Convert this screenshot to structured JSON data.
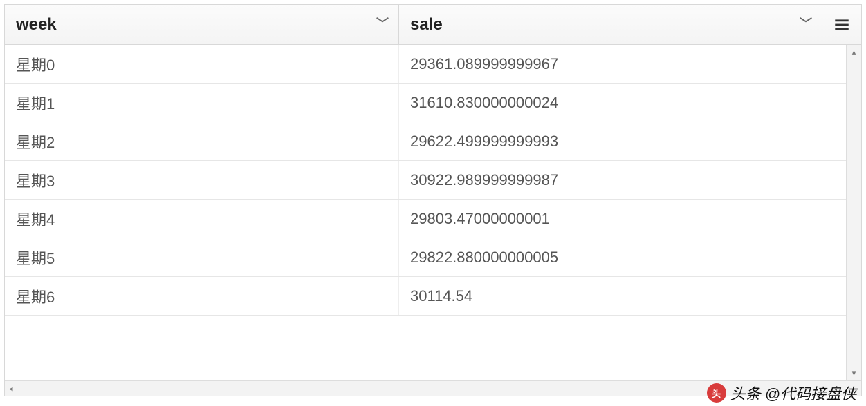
{
  "columns": [
    {
      "label": "week"
    },
    {
      "label": "sale"
    }
  ],
  "rows": [
    {
      "week": "星期0",
      "sale": "29361.089999999967"
    },
    {
      "week": "星期1",
      "sale": "31610.830000000024"
    },
    {
      "week": "星期2",
      "sale": "29622.499999999993"
    },
    {
      "week": "星期3",
      "sale": "30922.989999999987"
    },
    {
      "week": "星期4",
      "sale": "29803.47000000001"
    },
    {
      "week": "星期5",
      "sale": "29822.880000000005"
    },
    {
      "week": "星期6",
      "sale": "30114.54"
    }
  ],
  "watermark": {
    "prefix": "头条",
    "handle": "@代码接盘侠"
  },
  "chart_data": {
    "type": "table",
    "columns": [
      "week",
      "sale"
    ],
    "data": [
      [
        "星期0",
        29361.089999999967
      ],
      [
        "星期1",
        31610.830000000024
      ],
      [
        "星期2",
        29622.499999999993
      ],
      [
        "星期3",
        30922.989999999987
      ],
      [
        "星期4",
        29803.47000000001
      ],
      [
        "星期5",
        29822.880000000005
      ],
      [
        "星期6",
        30114.54
      ]
    ]
  }
}
